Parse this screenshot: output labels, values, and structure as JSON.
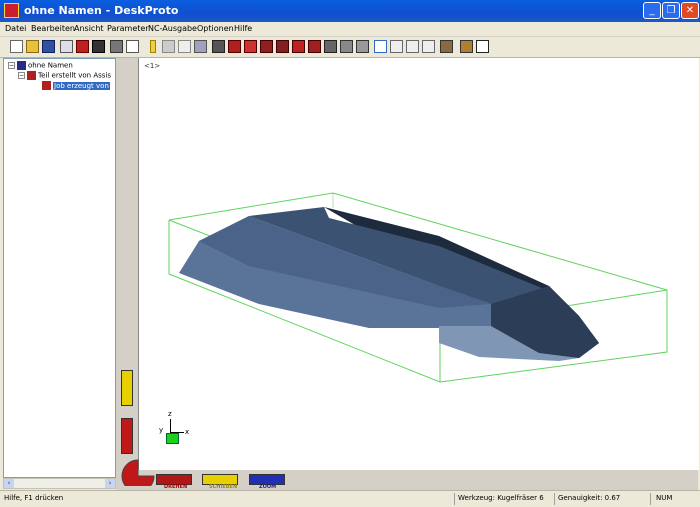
{
  "window": {
    "title": "ohne Namen - DeskProto"
  },
  "menu": [
    "Datei",
    "Bearbeiten",
    "Ansicht",
    "Parameter",
    "NC-Ausgabe",
    "Optionen",
    "Hilfe"
  ],
  "tree": {
    "root": "ohne Namen",
    "part": "Teil erstellt von Assis",
    "job": "Job erzeugt von"
  },
  "viewport": {
    "label": "<1>"
  },
  "axes": {
    "z": "z",
    "y": "y",
    "x": "x"
  },
  "modes": {
    "rotate": "DREHEN",
    "pan": "SCHIEBEN",
    "zoom": "ZOOM"
  },
  "status": {
    "help": "Hilfe, F1 drücken",
    "tool": "Werkzeug: Kugelfräser 6",
    "accuracy": "Genauigkeit: 0.67",
    "num": "NUM"
  }
}
